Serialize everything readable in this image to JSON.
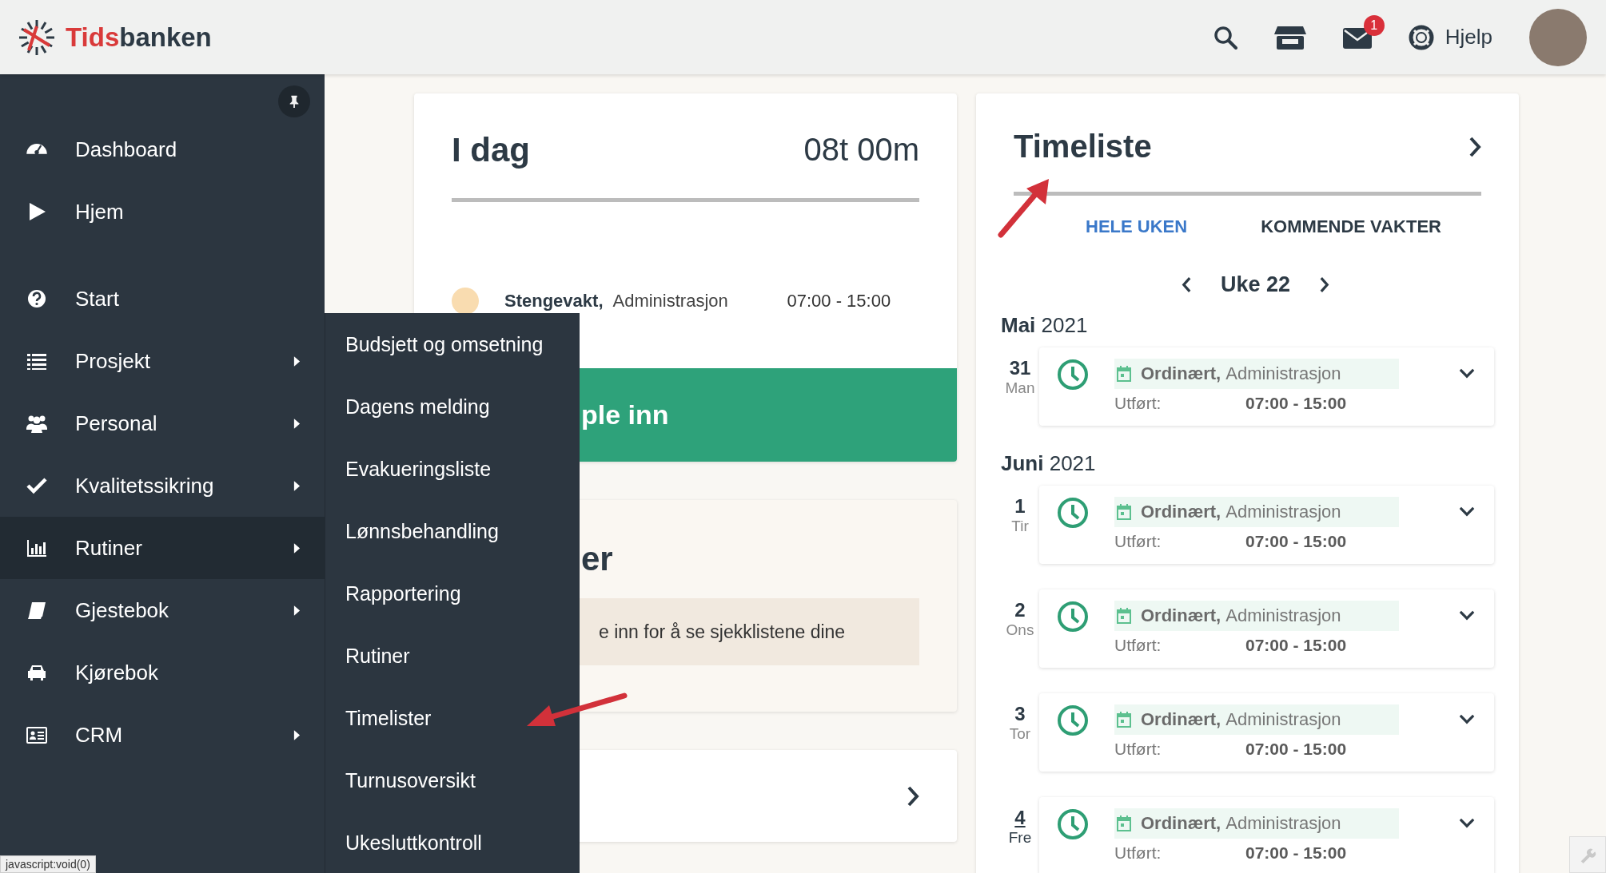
{
  "header": {
    "logo_part1": "Tids",
    "logo_part2": "banken",
    "mail_badge": "1",
    "help_label": "Hjelp"
  },
  "sidebar": {
    "items": [
      {
        "label": "Dashboard",
        "has_submenu": false,
        "selected": false
      },
      {
        "label": "Hjem",
        "has_submenu": false,
        "selected": false
      },
      {
        "label": "Start",
        "has_submenu": false,
        "selected": false
      },
      {
        "label": "Prosjekt",
        "has_submenu": true,
        "selected": false
      },
      {
        "label": "Personal",
        "has_submenu": true,
        "selected": false
      },
      {
        "label": "Kvalitetssikring",
        "has_submenu": true,
        "selected": false
      },
      {
        "label": "Rutiner",
        "has_submenu": true,
        "selected": true
      },
      {
        "label": "Gjestebok",
        "has_submenu": true,
        "selected": false
      },
      {
        "label": "Kjørebok",
        "has_submenu": false,
        "selected": false
      },
      {
        "label": "CRM",
        "has_submenu": true,
        "selected": false
      }
    ]
  },
  "submenu": {
    "items": [
      "Budsjett og omsetning",
      "Dagens melding",
      "Evakueringsliste",
      "Lønnsbehandling",
      "Rapportering",
      "Rutiner",
      "Timelister",
      "Turnusoversikt",
      "Ukesluttkontroll"
    ]
  },
  "today_card": {
    "title": "I dag",
    "total": "08t 00m",
    "shift": {
      "type": "Stengevakt,",
      "department": "Administrasjon",
      "time": "07:00 - 15:00",
      "color": "#f9dcb0"
    },
    "button": "ple inn"
  },
  "checklist_card": {
    "title": "er",
    "message": "e inn for å se sjekklistene dine"
  },
  "timesheet": {
    "title": "Timeliste",
    "tabs": [
      {
        "label": "HELE UKEN",
        "selected": true
      },
      {
        "label": "KOMMENDE VAKTER",
        "selected": false
      }
    ],
    "week": "Uke 22",
    "months": [
      {
        "title": "**Mai** 2021",
        "days": [
          {
            "day": "31",
            "weekday": "Man",
            "today": false,
            "type": "Ordinært,",
            "department": "Administrasjon",
            "label": "Utført:",
            "time": "07:00 - 15:00"
          }
        ]
      },
      {
        "title": "**Juni** 2021",
        "days": [
          {
            "day": "1",
            "weekday": "Tir",
            "today": false,
            "type": "Ordinært,",
            "department": "Administrasjon",
            "label": "Utført:",
            "time": "07:00 - 15:00"
          },
          {
            "day": "2",
            "weekday": "Ons",
            "today": false,
            "type": "Ordinært,",
            "department": "Administrasjon",
            "label": "Utført:",
            "time": "07:00 - 15:00"
          },
          {
            "day": "3",
            "weekday": "Tor",
            "today": false,
            "type": "Ordinært,",
            "department": "Administrasjon",
            "label": "Utført:",
            "time": "07:00 - 15:00"
          },
          {
            "day": "4",
            "weekday": "Fre",
            "today": true,
            "type": "Ordinært,",
            "department": "Administrasjon",
            "label": "Utført:",
            "time": "07:00 - 15:00"
          }
        ]
      }
    ]
  },
  "status_bar": "javascript:void(0)"
}
